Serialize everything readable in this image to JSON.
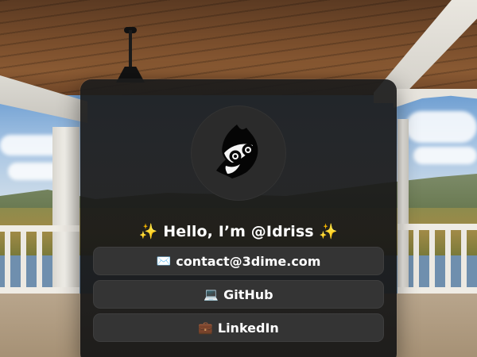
{
  "profile": {
    "greeting": "✨ Hello, I’m @Idriss ✨",
    "avatar_icon": "ghost-mask-logo-icon"
  },
  "links": [
    {
      "icon": "✉️",
      "label": "contact@3dime.com",
      "icon_name": "envelope-icon"
    },
    {
      "icon": "💻",
      "label": "GitHub",
      "icon_name": "laptop-icon"
    },
    {
      "icon": "💼",
      "label": "LinkedIn",
      "icon_name": "briefcase-icon"
    }
  ],
  "colors": {
    "card_bg": "#1c1c1c",
    "button_bg": "#343434",
    "text": "#ffffff"
  }
}
